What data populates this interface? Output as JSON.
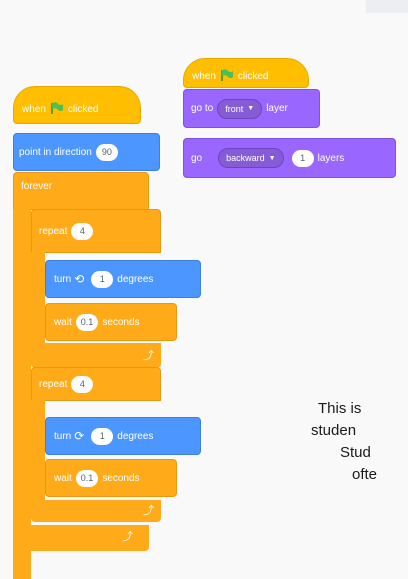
{
  "stack_right": {
    "hat_label": "when",
    "hat_suffix": "clicked",
    "goto_label": "go to",
    "goto_menu": "front",
    "goto_suffix": "layer",
    "go_label": "go",
    "go_menu": "backward",
    "go_value": "1",
    "go_suffix": "layers"
  },
  "stack_left": {
    "hat_label": "when",
    "hat_suffix": "clicked",
    "point_label": "point in direction",
    "point_value": "90",
    "forever_label": "forever",
    "repeat1_label": "repeat",
    "repeat1_value": "4",
    "turn1_label": "turn",
    "turn1_value": "1",
    "turn1_suffix": "degrees",
    "wait1_label": "wait",
    "wait1_value": "0.1",
    "wait1_suffix": "seconds",
    "repeat2_label": "repeat",
    "repeat2_value": "4",
    "turn2_label": "turn",
    "turn2_value": "1",
    "turn2_suffix": "degrees",
    "wait2_label": "wait",
    "wait2_value": "0.1",
    "wait2_suffix": "seconds"
  },
  "caption": {
    "line1": "This is",
    "line2": "studen",
    "line3": "Stud",
    "line4": "ofte"
  },
  "colors": {
    "events": "#ffbf00",
    "motion": "#4c97ff",
    "looks": "#9966ff",
    "control": "#ffab19"
  },
  "icons": [
    "green-flag-icon",
    "dropdown-arrow-icon",
    "rotate-left-icon",
    "rotate-right-icon",
    "loop-arrow-icon"
  ]
}
